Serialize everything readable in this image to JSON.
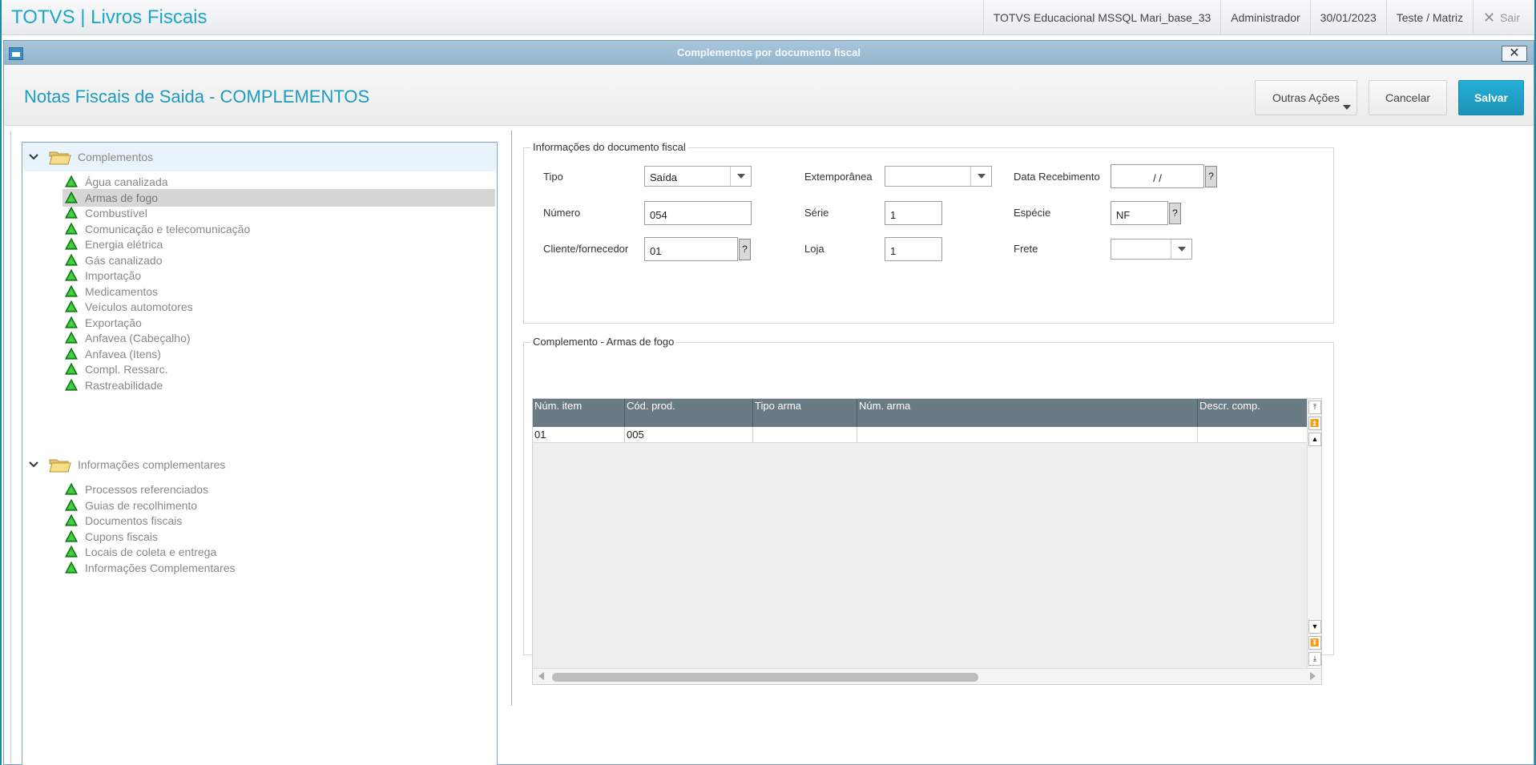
{
  "app": {
    "title": "TOTVS | Livros Fiscais"
  },
  "topbar": {
    "environment": "TOTVS Educacional MSSQL Mari_base_33",
    "user": "Administrador",
    "date": "30/01/2023",
    "branch": "Teste / Matriz",
    "exit_label": "Sair"
  },
  "dialog": {
    "title": "Complementos por documento fiscal",
    "form_title": "Notas Fiscais de Saida - COMPLEMENTOS",
    "buttons": {
      "other_actions": "Outras Ações",
      "cancel": "Cancelar",
      "save": "Salvar"
    }
  },
  "tree": {
    "root1": {
      "label": "Complementos",
      "items": [
        "Água canalizada",
        "Armas de fogo",
        "Combustível",
        "Comunicação e telecomunicação",
        "Energia elétrica",
        "Gás canalizado",
        "Importação",
        "Medicamentos",
        "Veículos automotores",
        "Exportação",
        "Anfavea (Cabeçalho)",
        "Anfavea (Itens)",
        "Compl. Ressarc.",
        "Rastreabilidade"
      ],
      "selected_index": 1
    },
    "root2": {
      "label": "Informações complementares",
      "items": [
        "Processos referenciados",
        "Guias de recolhimento",
        "Documentos fiscais",
        "Cupons fiscais",
        "Locais de coleta e entrega",
        "Informações Complementares"
      ]
    }
  },
  "doc_info": {
    "legend": "Informações do documento fiscal",
    "tipo": {
      "label": "Tipo",
      "value": "Saída"
    },
    "extemporanea": {
      "label": "Extemporânea",
      "value": ""
    },
    "data_recebimento": {
      "label": "Data Recebimento",
      "value": "/ /"
    },
    "numero": {
      "label": "Número",
      "value": "054"
    },
    "serie": {
      "label": "Série",
      "value": "1"
    },
    "especie": {
      "label": "Espécie",
      "value": "NF"
    },
    "cliente": {
      "label": "Cliente/fornecedor",
      "value": "01"
    },
    "loja": {
      "label": "Loja",
      "value": "1"
    },
    "frete": {
      "label": "Frete",
      "value": ""
    },
    "lookup_symbol": "?"
  },
  "complemento": {
    "legend": "Complemento - Armas de fogo",
    "columns": [
      "Núm. item",
      "Cód. prod.",
      "Tipo arma",
      "Núm. arma",
      "Descr. comp."
    ],
    "rows": [
      [
        "01",
        "005",
        "",
        "",
        ""
      ]
    ]
  },
  "colors": {
    "accent": "#1ea6c9",
    "save_button": "#1b9ec5",
    "grid_header": "#6b7b83",
    "tree_icon": "#22b522"
  }
}
